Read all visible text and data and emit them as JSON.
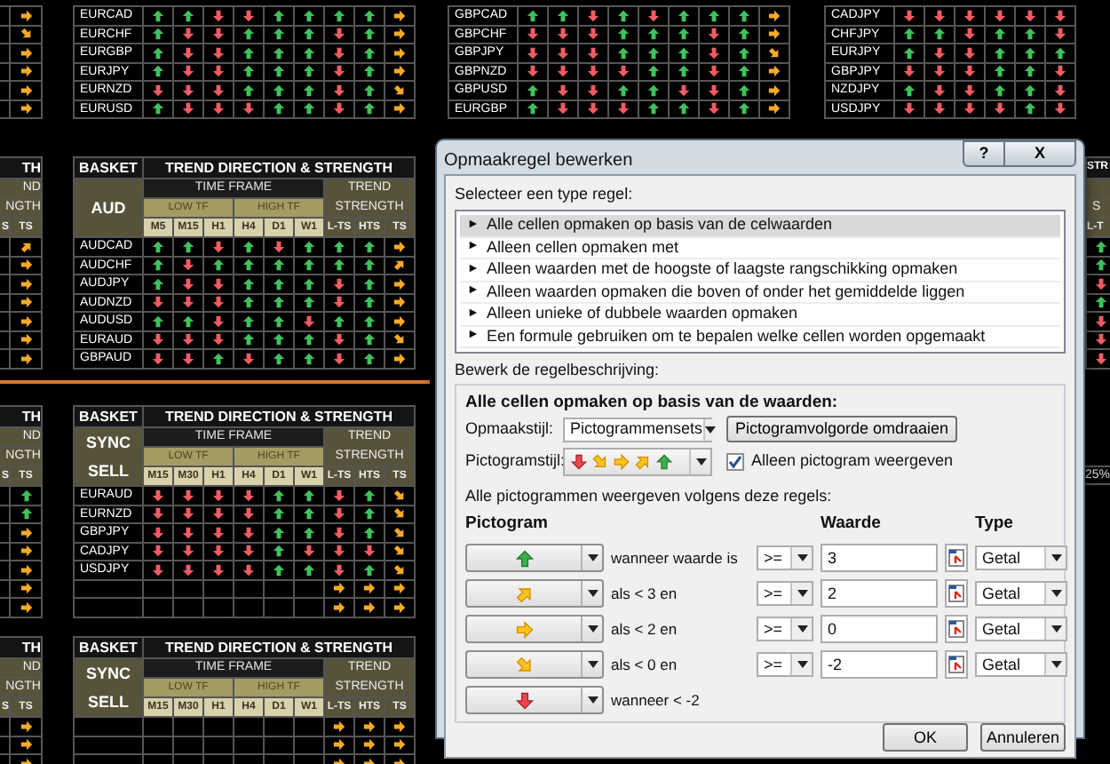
{
  "sheet": {
    "left_strip": {
      "top_arrows": [
        {
          "kind": "right"
        },
        {
          "kind": "downright"
        },
        {
          "kind": "right"
        },
        {
          "kind": "right"
        },
        {
          "kind": "right"
        },
        {
          "kind": "right"
        }
      ],
      "blocks": [
        {
          "title": "TH",
          "trend": "ND",
          "strength": "NGTH",
          "col_a": "S",
          "col_b": "TS",
          "arrows": [
            {
              "kind": "upright"
            },
            {
              "kind": "right"
            },
            {
              "kind": "right"
            },
            {
              "kind": "right"
            },
            {
              "kind": "right"
            },
            {
              "kind": "right"
            },
            {
              "kind": "right"
            }
          ]
        },
        {
          "title": "TH",
          "trend": "ND",
          "strength": "NGTH",
          "col_a": "S",
          "col_b": "TS",
          "arrows": [
            {
              "kind": "up"
            },
            {
              "kind": "up"
            },
            {
              "kind": "right"
            },
            {
              "kind": "right"
            },
            {
              "kind": "right"
            },
            {
              "kind": "right"
            },
            {
              "kind": "right"
            }
          ]
        },
        {
          "title": "TH",
          "trend": "ND",
          "strength": "NGTH",
          "col_a": "S",
          "col_b": "TS",
          "arrows": [
            {
              "kind": "right"
            },
            {
              "kind": "right"
            },
            {
              "kind": "right"
            }
          ]
        }
      ]
    },
    "top_panels": [
      {
        "rows": [
          {
            "pair": "EURCAD",
            "arrows": [
              {
                "kind": "up"
              },
              {
                "kind": "up"
              },
              {
                "kind": "down"
              },
              {
                "kind": "down"
              },
              {
                "kind": "up"
              },
              {
                "kind": "up"
              },
              {
                "kind": "up"
              },
              {
                "kind": "up"
              },
              {
                "kind": "right"
              }
            ]
          },
          {
            "pair": "EURCHF",
            "arrows": [
              {
                "kind": "up"
              },
              {
                "kind": "down"
              },
              {
                "kind": "down"
              },
              {
                "kind": "up"
              },
              {
                "kind": "up"
              },
              {
                "kind": "up"
              },
              {
                "kind": "down"
              },
              {
                "kind": "up"
              },
              {
                "kind": "right"
              }
            ]
          },
          {
            "pair": "EURGBP",
            "arrows": [
              {
                "kind": "up"
              },
              {
                "kind": "down"
              },
              {
                "kind": "down"
              },
              {
                "kind": "up"
              },
              {
                "kind": "up"
              },
              {
                "kind": "up"
              },
              {
                "kind": "down"
              },
              {
                "kind": "up"
              },
              {
                "kind": "right"
              }
            ]
          },
          {
            "pair": "EURJPY",
            "arrows": [
              {
                "kind": "up"
              },
              {
                "kind": "down"
              },
              {
                "kind": "down"
              },
              {
                "kind": "up"
              },
              {
                "kind": "up"
              },
              {
                "kind": "up"
              },
              {
                "kind": "down"
              },
              {
                "kind": "up"
              },
              {
                "kind": "right"
              }
            ]
          },
          {
            "pair": "EURNZD",
            "arrows": [
              {
                "kind": "down"
              },
              {
                "kind": "down"
              },
              {
                "kind": "down"
              },
              {
                "kind": "up"
              },
              {
                "kind": "up"
              },
              {
                "kind": "up"
              },
              {
                "kind": "down"
              },
              {
                "kind": "up"
              },
              {
                "kind": "downright"
              }
            ]
          },
          {
            "pair": "EURUSD",
            "arrows": [
              {
                "kind": "up"
              },
              {
                "kind": "down"
              },
              {
                "kind": "down"
              },
              {
                "kind": "down"
              },
              {
                "kind": "up"
              },
              {
                "kind": "up"
              },
              {
                "kind": "down"
              },
              {
                "kind": "up"
              },
              {
                "kind": "right"
              }
            ]
          }
        ]
      },
      {
        "rows": [
          {
            "pair": "GBPCAD",
            "arrows": [
              {
                "kind": "up"
              },
              {
                "kind": "up"
              },
              {
                "kind": "down"
              },
              {
                "kind": "up"
              },
              {
                "kind": "down"
              },
              {
                "kind": "up"
              },
              {
                "kind": "up"
              },
              {
                "kind": "up"
              },
              {
                "kind": "right"
              }
            ]
          },
          {
            "pair": "GBPCHF",
            "arrows": [
              {
                "kind": "down"
              },
              {
                "kind": "down"
              },
              {
                "kind": "down"
              },
              {
                "kind": "up"
              },
              {
                "kind": "up"
              },
              {
                "kind": "up"
              },
              {
                "kind": "down"
              },
              {
                "kind": "up"
              },
              {
                "kind": "right"
              }
            ]
          },
          {
            "pair": "GBPJPY",
            "arrows": [
              {
                "kind": "down"
              },
              {
                "kind": "down"
              },
              {
                "kind": "down"
              },
              {
                "kind": "up"
              },
              {
                "kind": "up"
              },
              {
                "kind": "up"
              },
              {
                "kind": "down"
              },
              {
                "kind": "up"
              },
              {
                "kind": "downright"
              }
            ]
          },
          {
            "pair": "GBPNZD",
            "arrows": [
              {
                "kind": "down"
              },
              {
                "kind": "down"
              },
              {
                "kind": "down"
              },
              {
                "kind": "down"
              },
              {
                "kind": "up"
              },
              {
                "kind": "up"
              },
              {
                "kind": "down"
              },
              {
                "kind": "up"
              },
              {
                "kind": "right"
              }
            ]
          },
          {
            "pair": "GBPUSD",
            "arrows": [
              {
                "kind": "up"
              },
              {
                "kind": "down"
              },
              {
                "kind": "down"
              },
              {
                "kind": "up"
              },
              {
                "kind": "up"
              },
              {
                "kind": "down"
              },
              {
                "kind": "down"
              },
              {
                "kind": "up"
              },
              {
                "kind": "right"
              }
            ]
          },
          {
            "pair": "EURGBP",
            "arrows": [
              {
                "kind": "up"
              },
              {
                "kind": "down"
              },
              {
                "kind": "down"
              },
              {
                "kind": "down"
              },
              {
                "kind": "up"
              },
              {
                "kind": "up"
              },
              {
                "kind": "down"
              },
              {
                "kind": "up"
              },
              {
                "kind": "right"
              }
            ]
          }
        ]
      },
      {
        "rows": [
          {
            "pair": "CADJPY",
            "arrows": [
              {
                "kind": "down"
              },
              {
                "kind": "down"
              },
              {
                "kind": "down"
              },
              {
                "kind": "down"
              },
              {
                "kind": "down"
              },
              {
                "kind": "down"
              }
            ]
          },
          {
            "pair": "CHFJPY",
            "arrows": [
              {
                "kind": "up"
              },
              {
                "kind": "up"
              },
              {
                "kind": "down"
              },
              {
                "kind": "up"
              },
              {
                "kind": "up"
              },
              {
                "kind": "down"
              }
            ]
          },
          {
            "pair": "EURJPY",
            "arrows": [
              {
                "kind": "up"
              },
              {
                "kind": "down"
              },
              {
                "kind": "down"
              },
              {
                "kind": "up"
              },
              {
                "kind": "up"
              },
              {
                "kind": "up"
              }
            ]
          },
          {
            "pair": "GBPJPY",
            "arrows": [
              {
                "kind": "down"
              },
              {
                "kind": "down"
              },
              {
                "kind": "down"
              },
              {
                "kind": "up"
              },
              {
                "kind": "up"
              },
              {
                "kind": "down"
              }
            ]
          },
          {
            "pair": "NZDJPY",
            "arrows": [
              {
                "kind": "up"
              },
              {
                "kind": "down"
              },
              {
                "kind": "down"
              },
              {
                "kind": "up"
              },
              {
                "kind": "up"
              },
              {
                "kind": "down"
              }
            ]
          },
          {
            "pair": "USDJPY",
            "arrows": [
              {
                "kind": "down"
              },
              {
                "kind": "down"
              },
              {
                "kind": "down"
              },
              {
                "kind": "down"
              },
              {
                "kind": "up"
              },
              {
                "kind": "down"
              }
            ]
          }
        ]
      }
    ],
    "basket_panels": [
      {
        "basket": "BASKET",
        "title": "TREND DIRECTION & STRENGTH",
        "time_frame": "TIME FRAME",
        "trend": "TREND",
        "strength": "STRENGTH",
        "low_tf": "LOW TF",
        "high_tf": "HIGH TF",
        "name_lines": [
          "AUD"
        ],
        "columns": [
          "M5",
          "M15",
          "H1",
          "H4",
          "D1",
          "W1",
          "L-TS",
          "HTS",
          "TS"
        ],
        "rows": [
          {
            "pair": "AUDCAD",
            "arrows": [
              {
                "kind": "up"
              },
              {
                "kind": "up"
              },
              {
                "kind": "down"
              },
              {
                "kind": "up"
              },
              {
                "kind": "down"
              },
              {
                "kind": "up"
              },
              {
                "kind": "up"
              },
              {
                "kind": "up"
              },
              {
                "kind": "right"
              }
            ]
          },
          {
            "pair": "AUDCHF",
            "arrows": [
              {
                "kind": "up"
              },
              {
                "kind": "down"
              },
              {
                "kind": "up"
              },
              {
                "kind": "up"
              },
              {
                "kind": "up"
              },
              {
                "kind": "up"
              },
              {
                "kind": "up"
              },
              {
                "kind": "up"
              },
              {
                "kind": "upright"
              }
            ]
          },
          {
            "pair": "AUDJPY",
            "arrows": [
              {
                "kind": "up"
              },
              {
                "kind": "down"
              },
              {
                "kind": "down"
              },
              {
                "kind": "up"
              },
              {
                "kind": "up"
              },
              {
                "kind": "up"
              },
              {
                "kind": "down"
              },
              {
                "kind": "up"
              },
              {
                "kind": "right"
              }
            ]
          },
          {
            "pair": "AUDNZD",
            "arrows": [
              {
                "kind": "down"
              },
              {
                "kind": "down"
              },
              {
                "kind": "down"
              },
              {
                "kind": "up"
              },
              {
                "kind": "up"
              },
              {
                "kind": "up"
              },
              {
                "kind": "down"
              },
              {
                "kind": "up"
              },
              {
                "kind": "right"
              }
            ]
          },
          {
            "pair": "AUDUSD",
            "arrows": [
              {
                "kind": "up"
              },
              {
                "kind": "up"
              },
              {
                "kind": "down"
              },
              {
                "kind": "up"
              },
              {
                "kind": "up"
              },
              {
                "kind": "down"
              },
              {
                "kind": "up"
              },
              {
                "kind": "up"
              },
              {
                "kind": "right"
              }
            ]
          },
          {
            "pair": "EURAUD",
            "arrows": [
              {
                "kind": "down"
              },
              {
                "kind": "down"
              },
              {
                "kind": "down"
              },
              {
                "kind": "up"
              },
              {
                "kind": "up"
              },
              {
                "kind": "up"
              },
              {
                "kind": "down"
              },
              {
                "kind": "up"
              },
              {
                "kind": "downright"
              }
            ]
          },
          {
            "pair": "GBPAUD",
            "arrows": [
              {
                "kind": "down"
              },
              {
                "kind": "down"
              },
              {
                "kind": "up"
              },
              {
                "kind": "down"
              },
              {
                "kind": "up"
              },
              {
                "kind": "up"
              },
              {
                "kind": "down"
              },
              {
                "kind": "up"
              },
              {
                "kind": "right"
              }
            ]
          }
        ]
      },
      {
        "basket": "BASKET",
        "title": "TREND DIRECTION & STRENGTH",
        "time_frame": "TIME FRAME",
        "trend": "TREND",
        "strength": "STRENGTH",
        "low_tf": "LOW TF",
        "high_tf": "HIGH TF",
        "name_lines": [
          "SYNC",
          "SELL"
        ],
        "columns": [
          "M15",
          "M30",
          "H1",
          "H4",
          "D1",
          "W1",
          "L-TS",
          "HTS",
          "TS"
        ],
        "rows": [
          {
            "pair": "EURAUD",
            "arrows": [
              {
                "kind": "down"
              },
              {
                "kind": "down"
              },
              {
                "kind": "down"
              },
              {
                "kind": "down"
              },
              {
                "kind": "up"
              },
              {
                "kind": "up"
              },
              {
                "kind": "down"
              },
              {
                "kind": "up"
              },
              {
                "kind": "downright"
              }
            ]
          },
          {
            "pair": "EURNZD",
            "arrows": [
              {
                "kind": "down"
              },
              {
                "kind": "down"
              },
              {
                "kind": "down"
              },
              {
                "kind": "down"
              },
              {
                "kind": "up"
              },
              {
                "kind": "up"
              },
              {
                "kind": "down"
              },
              {
                "kind": "up"
              },
              {
                "kind": "downright"
              }
            ]
          },
          {
            "pair": "GBPJPY",
            "arrows": [
              {
                "kind": "down"
              },
              {
                "kind": "down"
              },
              {
                "kind": "down"
              },
              {
                "kind": "down"
              },
              {
                "kind": "up"
              },
              {
                "kind": "up"
              },
              {
                "kind": "down"
              },
              {
                "kind": "up"
              },
              {
                "kind": "downright"
              }
            ]
          },
          {
            "pair": "CADJPY",
            "arrows": [
              {
                "kind": "down"
              },
              {
                "kind": "down"
              },
              {
                "kind": "down"
              },
              {
                "kind": "down"
              },
              {
                "kind": "up"
              },
              {
                "kind": "down"
              },
              {
                "kind": "down"
              },
              {
                "kind": "down"
              },
              {
                "kind": "downright"
              }
            ]
          },
          {
            "pair": "USDJPY",
            "arrows": [
              {
                "kind": "down"
              },
              {
                "kind": "down"
              },
              {
                "kind": "down"
              },
              {
                "kind": "down"
              },
              {
                "kind": "up"
              },
              {
                "kind": "up"
              },
              {
                "kind": "down"
              },
              {
                "kind": "up"
              },
              {
                "kind": "downright"
              }
            ]
          },
          {
            "arrows": [
              {
                "kind": "none"
              },
              {
                "kind": "none"
              },
              {
                "kind": "none"
              },
              {
                "kind": "none"
              },
              {
                "kind": "none"
              },
              {
                "kind": "none"
              },
              {
                "kind": "right"
              },
              {
                "kind": "right"
              },
              {
                "kind": "right"
              }
            ]
          },
          {
            "arrows": [
              {
                "kind": "none"
              },
              {
                "kind": "none"
              },
              {
                "kind": "none"
              },
              {
                "kind": "none"
              },
              {
                "kind": "none"
              },
              {
                "kind": "none"
              },
              {
                "kind": "right"
              },
              {
                "kind": "right"
              },
              {
                "kind": "right"
              }
            ]
          }
        ]
      },
      {
        "basket": "BASKET",
        "title": "TREND DIRECTION & STRENGTH",
        "time_frame": "TIME FRAME",
        "trend": "TREND",
        "strength": "STRENGTH",
        "low_tf": "LOW TF",
        "high_tf": "HIGH TF",
        "name_lines": [
          "SYNC",
          "SELL"
        ],
        "columns": [
          "M15",
          "M30",
          "H1",
          "H4",
          "D1",
          "W1",
          "L-TS",
          "HTS",
          "TS"
        ],
        "rows": [
          {
            "arrows": [
              {
                "kind": "none"
              },
              {
                "kind": "none"
              },
              {
                "kind": "none"
              },
              {
                "kind": "none"
              },
              {
                "kind": "none"
              },
              {
                "kind": "none"
              },
              {
                "kind": "right"
              },
              {
                "kind": "right"
              },
              {
                "kind": "right"
              }
            ]
          },
          {
            "arrows": [
              {
                "kind": "none"
              },
              {
                "kind": "none"
              },
              {
                "kind": "none"
              },
              {
                "kind": "none"
              },
              {
                "kind": "none"
              },
              {
                "kind": "none"
              },
              {
                "kind": "right"
              },
              {
                "kind": "right"
              },
              {
                "kind": "right"
              }
            ]
          },
          {
            "arrows": [
              {
                "kind": "none"
              },
              {
                "kind": "none"
              },
              {
                "kind": "none"
              },
              {
                "kind": "none"
              },
              {
                "kind": "none"
              },
              {
                "kind": "none"
              },
              {
                "kind": "right"
              },
              {
                "kind": "right"
              },
              {
                "kind": "right"
              }
            ]
          }
        ]
      }
    ],
    "right_strip": {
      "title": "STR",
      "strength": "S",
      "column": "L-T",
      "arrows": [
        {
          "kind": "up"
        },
        {
          "kind": "up"
        },
        {
          "kind": "down"
        },
        {
          "kind": "up"
        },
        {
          "kind": "down"
        },
        {
          "kind": "down"
        },
        {
          "kind": "down"
        }
      ],
      "reading": "25%"
    }
  },
  "dialog": {
    "title": "Opmaakregel bewerken",
    "help": "?",
    "close": "X",
    "select_label": "Selecteer een type regel:",
    "rule_types": [
      {
        "marker": "►",
        "label": "Alle cellen opmaken op basis van de celwaarden",
        "selected": true
      },
      {
        "marker": "►",
        "label": "Alleen cellen opmaken met",
        "selected": false
      },
      {
        "marker": "►",
        "label": "Alleen waarden met de hoogste of laagste rangschikking opmaken",
        "selected": false
      },
      {
        "marker": "►",
        "label": "Alleen waarden opmaken die boven of onder het gemiddelde liggen",
        "selected": false
      },
      {
        "marker": "►",
        "label": "Alleen unieke of dubbele waarden opmaken",
        "selected": false
      },
      {
        "marker": "►",
        "label": "Een formule gebruiken om te bepalen welke cellen worden opgemaakt",
        "selected": false
      }
    ],
    "edit_label": "Bewerk de regelbeschrijving:",
    "heading": "Alle cellen opmaken op basis van de waarden:",
    "style_label": "Opmaakstijl:",
    "style_value": "Pictogrammensets",
    "reverse_button": "Pictogramvolgorde omdraaien",
    "icon_style_label": "Pictogramstijl:",
    "icon_set": [
      {
        "kind": "down"
      },
      {
        "kind": "downright"
      },
      {
        "kind": "right"
      },
      {
        "kind": "upright"
      },
      {
        "kind": "up"
      }
    ],
    "icon_only": {
      "label": "Alleen pictogram weergeven",
      "checked": true
    },
    "rules_label": "Alle pictogrammen weergeven volgens deze regels:",
    "headers": {
      "icon": "Pictogram",
      "value": "Waarde",
      "type": "Type"
    },
    "rules": [
      {
        "kind": "up",
        "condition": "wanneer waarde is",
        "operator": ">=",
        "value": "3",
        "type": "Getal"
      },
      {
        "kind": "upright",
        "condition": "als < 3 en",
        "operator": ">=",
        "value": "2",
        "type": "Getal"
      },
      {
        "kind": "right",
        "condition": "als < 2 en",
        "operator": ">=",
        "value": "0",
        "type": "Getal"
      },
      {
        "kind": "downright",
        "condition": "als < 0 en",
        "operator": ">=",
        "value": "-2",
        "type": "Getal"
      },
      {
        "kind": "down",
        "condition": "wanneer < -2"
      }
    ],
    "buttons": [
      "OK",
      "Annuleren"
    ]
  }
}
